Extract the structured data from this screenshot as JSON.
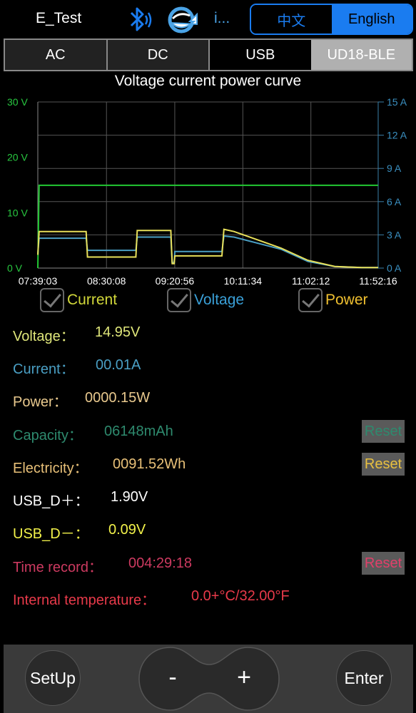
{
  "header": {
    "title": "E_Test",
    "bluetooth_icon": "bluetooth-icon",
    "sync_icon": "refresh-icon",
    "ellipsis": "i...",
    "lang_cn": "中文",
    "lang_en": "English",
    "selected_lang": "English"
  },
  "tabs": [
    "AC",
    "DC",
    "USB",
    "UD18-BLE"
  ],
  "active_tab": "UD18-BLE",
  "chart_data": {
    "type": "line",
    "title": "Voltage current power curve",
    "x_ticks": [
      "07:39:03",
      "08:30:08",
      "09:20:56",
      "10:11:34",
      "11:02:12",
      "11:52:16"
    ],
    "y_left_ticks": [
      "30 V",
      "20 V",
      "10 V",
      "0 V"
    ],
    "y_right_ticks": [
      "15 A",
      "12 A",
      "9 A",
      "6 A",
      "3 A",
      "0 A"
    ],
    "ylim_left": [
      0,
      30
    ],
    "ylim_right": [
      0,
      15
    ],
    "grid": true,
    "series": [
      {
        "name": "Voltage",
        "color": "#22c833",
        "x": [
          "07:39:03",
          "07:40:00",
          "11:52:16",
          "12:00:00"
        ],
        "values": [
          0,
          14.95,
          14.95,
          14.95
        ]
      },
      {
        "name": "Current",
        "color": "#4a9fc4",
        "x": [
          "07:39:03",
          "07:40:00",
          "08:15:00",
          "08:16:00",
          "08:52:00",
          "08:53:00",
          "09:18:00",
          "09:19:00",
          "09:20:30",
          "09:21:00",
          "09:56:00",
          "09:57:30",
          "10:05:00",
          "10:40:00",
          "11:00:00",
          "11:20:00",
          "11:40:00",
          "12:00:00"
        ],
        "values": [
          1.3,
          2.7,
          2.7,
          1.6,
          1.6,
          2.8,
          2.8,
          0.5,
          0.5,
          1.5,
          1.5,
          2.9,
          2.8,
          1.7,
          0.6,
          0.15,
          0.05,
          0.05
        ]
      },
      {
        "name": "Power",
        "color": "#e8e05a",
        "x": [
          "07:39:03",
          "07:40:00",
          "08:15:00",
          "08:16:00",
          "08:52:00",
          "08:53:00",
          "09:18:00",
          "09:19:00",
          "09:20:30",
          "09:21:00",
          "09:56:00",
          "09:57:30",
          "10:05:00",
          "10:40:00",
          "11:00:00",
          "11:20:00",
          "11:40:00",
          "12:00:00"
        ],
        "values": [
          1.2,
          3.3,
          3.3,
          1.0,
          1.0,
          3.4,
          3.4,
          0.4,
          0.4,
          1.1,
          1.1,
          3.5,
          3.3,
          1.8,
          0.7,
          0.15,
          0.05,
          0.05
        ]
      }
    ]
  },
  "checkboxes": [
    {
      "label": "Current",
      "color": "#d2d83a"
    },
    {
      "label": "Voltage",
      "color": "#3aa0d8"
    },
    {
      "label": "Power",
      "color": "#f0c030"
    }
  ],
  "readings": {
    "voltage": {
      "label": "Voltage：",
      "value": "14.95V",
      "color": "#dfe67a"
    },
    "current": {
      "label": "Current：",
      "value": "00.01A",
      "color": "#4a9fc4"
    },
    "power": {
      "label": "Power：",
      "value": "0000.15W",
      "color": "#e9c98e"
    },
    "capacity": {
      "label": "Capacity：",
      "value": "06148mAh",
      "color": "#2e8a6e",
      "reset": "Reset"
    },
    "electricity": {
      "label": "Electricity：",
      "value": "0091.52Wh",
      "color": "#e8c078",
      "reset": "Reset",
      "reset_color": "#e8c040"
    },
    "usb_dp": {
      "label": "USB_D＋：",
      "value": "1.90V",
      "color": "#ffffff"
    },
    "usb_dm": {
      "label": "USB_D－：",
      "value": "0.09V",
      "color": "#f2f24a"
    },
    "time_record": {
      "label": "Time record：",
      "value": "004:29:18",
      "color": "#cc3a60",
      "reset": "Reset",
      "reset_color": "#e0406a"
    },
    "internal_temp": {
      "label": "Internal temperature：",
      "value": "0.0+°C/32.00°F",
      "color": "#e83a4a"
    }
  },
  "controls": {
    "setup": "SetUp",
    "minus": "-",
    "plus": "+",
    "enter": "Enter"
  }
}
